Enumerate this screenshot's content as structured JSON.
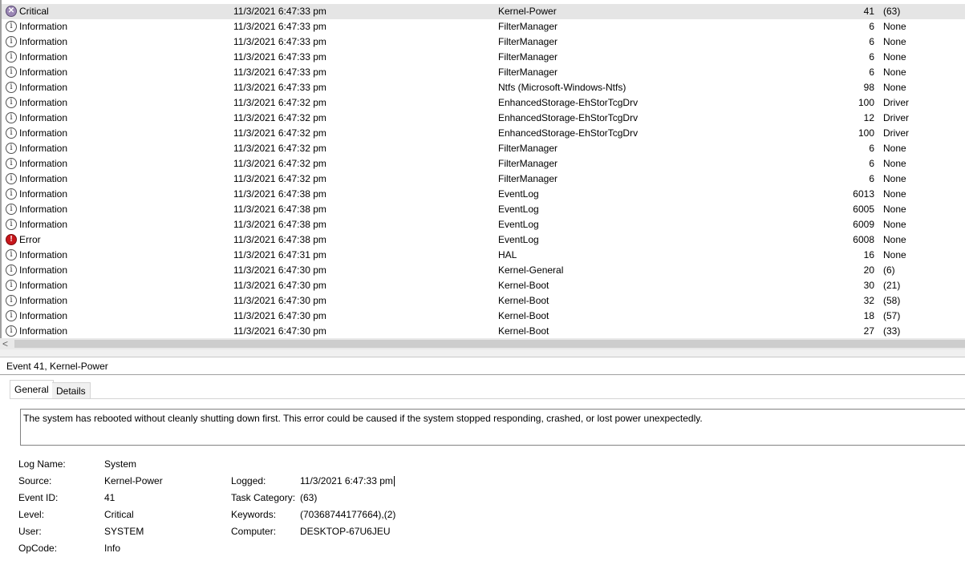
{
  "events": [
    {
      "level": "Critical",
      "icon": "critical-icon",
      "date": "11/3/2021 6:47:33 pm",
      "source": "Kernel-Power",
      "event_id": "41",
      "task": "(63)",
      "selected": true
    },
    {
      "level": "Information",
      "icon": "info-icon",
      "date": "11/3/2021 6:47:33 pm",
      "source": "FilterManager",
      "event_id": "6",
      "task": "None"
    },
    {
      "level": "Information",
      "icon": "info-icon",
      "date": "11/3/2021 6:47:33 pm",
      "source": "FilterManager",
      "event_id": "6",
      "task": "None"
    },
    {
      "level": "Information",
      "icon": "info-icon",
      "date": "11/3/2021 6:47:33 pm",
      "source": "FilterManager",
      "event_id": "6",
      "task": "None"
    },
    {
      "level": "Information",
      "icon": "info-icon",
      "date": "11/3/2021 6:47:33 pm",
      "source": "FilterManager",
      "event_id": "6",
      "task": "None"
    },
    {
      "level": "Information",
      "icon": "info-icon",
      "date": "11/3/2021 6:47:33 pm",
      "source": "Ntfs (Microsoft-Windows-Ntfs)",
      "event_id": "98",
      "task": "None"
    },
    {
      "level": "Information",
      "icon": "info-icon",
      "date": "11/3/2021 6:47:32 pm",
      "source": "EnhancedStorage-EhStorTcgDrv",
      "event_id": "100",
      "task": "Driver"
    },
    {
      "level": "Information",
      "icon": "info-icon",
      "date": "11/3/2021 6:47:32 pm",
      "source": "EnhancedStorage-EhStorTcgDrv",
      "event_id": "12",
      "task": "Driver"
    },
    {
      "level": "Information",
      "icon": "info-icon",
      "date": "11/3/2021 6:47:32 pm",
      "source": "EnhancedStorage-EhStorTcgDrv",
      "event_id": "100",
      "task": "Driver"
    },
    {
      "level": "Information",
      "icon": "info-icon",
      "date": "11/3/2021 6:47:32 pm",
      "source": "FilterManager",
      "event_id": "6",
      "task": "None"
    },
    {
      "level": "Information",
      "icon": "info-icon",
      "date": "11/3/2021 6:47:32 pm",
      "source": "FilterManager",
      "event_id": "6",
      "task": "None"
    },
    {
      "level": "Information",
      "icon": "info-icon",
      "date": "11/3/2021 6:47:32 pm",
      "source": "FilterManager",
      "event_id": "6",
      "task": "None"
    },
    {
      "level": "Information",
      "icon": "info-icon",
      "date": "11/3/2021 6:47:38 pm",
      "source": "EventLog",
      "event_id": "6013",
      "task": "None"
    },
    {
      "level": "Information",
      "icon": "info-icon",
      "date": "11/3/2021 6:47:38 pm",
      "source": "EventLog",
      "event_id": "6005",
      "task": "None"
    },
    {
      "level": "Information",
      "icon": "info-icon",
      "date": "11/3/2021 6:47:38 pm",
      "source": "EventLog",
      "event_id": "6009",
      "task": "None"
    },
    {
      "level": "Error",
      "icon": "error-icon",
      "date": "11/3/2021 6:47:38 pm",
      "source": "EventLog",
      "event_id": "6008",
      "task": "None"
    },
    {
      "level": "Information",
      "icon": "info-icon",
      "date": "11/3/2021 6:47:31 pm",
      "source": "HAL",
      "event_id": "16",
      "task": "None"
    },
    {
      "level": "Information",
      "icon": "info-icon",
      "date": "11/3/2021 6:47:30 pm",
      "source": "Kernel-General",
      "event_id": "20",
      "task": "(6)"
    },
    {
      "level": "Information",
      "icon": "info-icon",
      "date": "11/3/2021 6:47:30 pm",
      "source": "Kernel-Boot",
      "event_id": "30",
      "task": "(21)"
    },
    {
      "level": "Information",
      "icon": "info-icon",
      "date": "11/3/2021 6:47:30 pm",
      "source": "Kernel-Boot",
      "event_id": "32",
      "task": "(58)"
    },
    {
      "level": "Information",
      "icon": "info-icon",
      "date": "11/3/2021 6:47:30 pm",
      "source": "Kernel-Boot",
      "event_id": "18",
      "task": "(57)"
    },
    {
      "level": "Information",
      "icon": "info-icon",
      "date": "11/3/2021 6:47:30 pm",
      "source": "Kernel-Boot",
      "event_id": "27",
      "task": "(33)"
    }
  ],
  "details": {
    "title": "Event 41, Kernel-Power",
    "tabs": {
      "general": "General",
      "details": "Details"
    },
    "description": "The system has rebooted without cleanly shutting down first. This error could be caused if the system stopped responding, crashed, or lost power unexpectedly.",
    "labels": {
      "log_name": "Log Name:",
      "source": "Source:",
      "event_id": "Event ID:",
      "level": "Level:",
      "user": "User:",
      "opcode": "OpCode:",
      "logged": "Logged:",
      "task_category": "Task Category:",
      "keywords": "Keywords:",
      "computer": "Computer:"
    },
    "values": {
      "log_name": "System",
      "source": "Kernel-Power",
      "event_id": "41",
      "level": "Critical",
      "user": "SYSTEM",
      "opcode": "Info",
      "logged": "11/3/2021 6:47:33 pm",
      "task_category": "(63)",
      "keywords": "(70368744177664),(2)",
      "computer": "DESKTOP-67U6JEU"
    }
  },
  "scrollbar": {
    "left_arrow": "<"
  },
  "colors": {
    "selected_row": "#e5e5e5",
    "critical": "#9b87b5",
    "error": "#c7161b"
  }
}
